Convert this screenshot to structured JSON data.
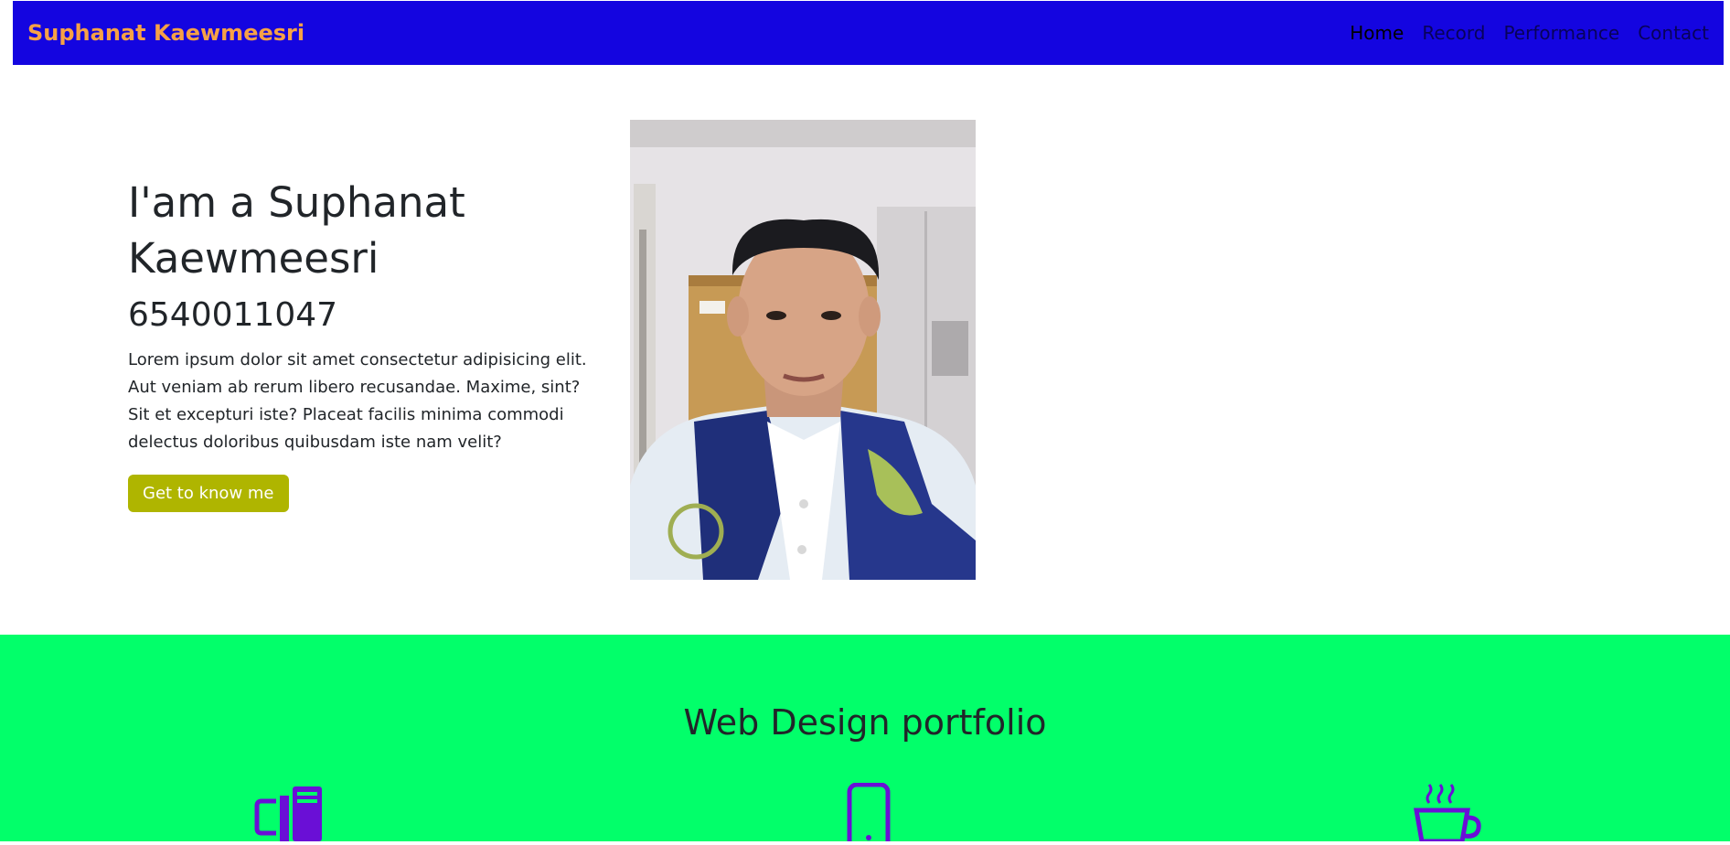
{
  "navbar": {
    "brand": "Suphanat Kaewmeesri",
    "links": [
      {
        "label": "Home",
        "active": true
      },
      {
        "label": "Record",
        "active": false
      },
      {
        "label": "Performance",
        "active": false
      },
      {
        "label": "Contact",
        "active": false
      }
    ]
  },
  "hero": {
    "title": "I'am a Suphanat Kaewmeesri",
    "student_id": "6540011047",
    "description": "Lorem ipsum dolor sit amet consectetur adipisicing elit. Aut veniam ab rerum libero recusandae. Maxime, sint? Sit et excepturi iste? Placeat facilis minima commodi delectus doloribus quibusdam iste nam velit?",
    "button_label": "Get to know me"
  },
  "portfolio": {
    "title": "Web Design portfolio",
    "icons": [
      "books-icon",
      "smartphone-icon",
      "coffee-cup-icon"
    ]
  },
  "colors": {
    "navbar_bg": "#1405e0",
    "brand": "#f6a146",
    "button_bg": "#afb500",
    "section_bg": "#02ff6a",
    "icon": "#6a0fd6"
  }
}
